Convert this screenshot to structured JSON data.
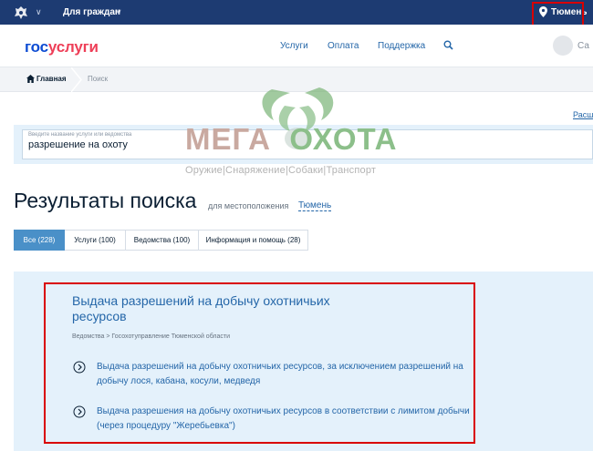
{
  "topbar": {
    "menu_label": "Для граждан",
    "location": "Тюмень",
    "icons": [
      "emblem-icon",
      "chevron-down-icon",
      "location-pin-icon"
    ]
  },
  "header": {
    "logo_part1": "гос",
    "logo_part2": "услуги",
    "nav": [
      {
        "label": "Услуги"
      },
      {
        "label": "Оплата"
      },
      {
        "label": "Поддержка"
      }
    ],
    "user_name": "Са"
  },
  "breadcrumb": {
    "home": "Главная",
    "current": "Поиск"
  },
  "extended_link": "Расш",
  "search": {
    "hint": "Введите название услуги или ведомства",
    "value": "разрешение на охоту"
  },
  "watermark": {
    "title_part1": "МЕГА",
    "title_part2": "ОХОТА",
    "subtitle": "Оружие|Снаряжение|Собаки|Транспорт"
  },
  "results": {
    "title": "Результаты поиска",
    "for_location": "для местоположения",
    "city": "Тюмень",
    "tabs": [
      {
        "label": "Все (228)",
        "active": true
      },
      {
        "label": "Услуги (100)",
        "active": false
      },
      {
        "label": "Ведомства (100)",
        "active": false
      },
      {
        "label": "Информация и помощь (28)",
        "active": false
      }
    ]
  },
  "card": {
    "title": "Выдача разрешений на добычу охотничьих ресурсов",
    "crumb": "Ведомства > Госохотуправление Тюменской области",
    "items": [
      {
        "text": "Выдача разрешений на добычу охотничьих ресурсов, за исключением разрешений на добычу лося, кабана, косули, медведя"
      },
      {
        "text": "Выдача разрешения на добычу охотничьих ресурсов в соответствии с лимитом добычи (через процедуру \"Жеребьевка\")"
      }
    ]
  },
  "colors": {
    "topbar": "#1d3b72",
    "link": "#2466a8",
    "highlight_box": "#d90000",
    "panel": "#e4f1fb",
    "tab_active": "#4a90c8"
  }
}
